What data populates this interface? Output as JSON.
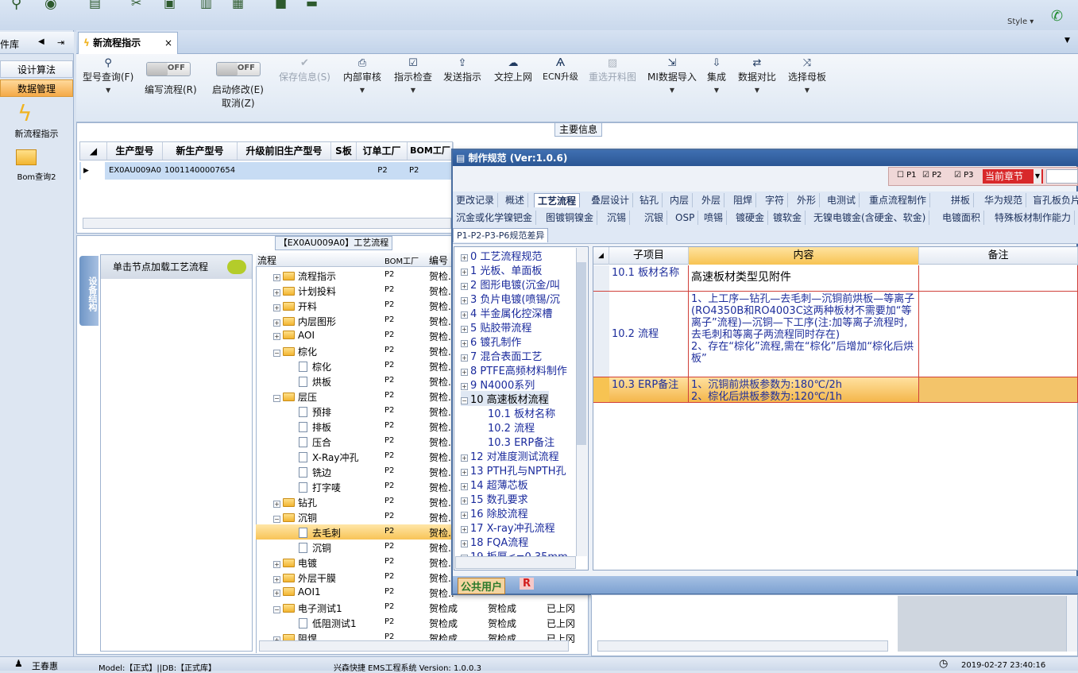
{
  "window": {
    "style_label": "Style ▾"
  },
  "sidebar": {
    "header": "件库",
    "buttons": [
      {
        "label": "设计算法"
      },
      {
        "label": "数据管理"
      }
    ],
    "items": [
      {
        "label": "新流程指示"
      },
      {
        "label": "Bom查询2"
      }
    ]
  },
  "tab": {
    "label": "新流程指示",
    "close": "×"
  },
  "toolbar": {
    "query": "型号查询(F)",
    "edit_flow": "编写流程(R)",
    "start_edit": "启动修改(E)",
    "cancel": "取消(Z)",
    "toggle_off": "OFF",
    "save_info": "保存信息(S)",
    "internal_review": "内部审核",
    "instruction_check": "指示检查",
    "send_instruction": "发送指示",
    "doc_upload": "文控上网",
    "ecn_upgrade": "ECN升级",
    "reselect_cut": "重选开料图",
    "mi_import": "MI数据导入",
    "integrate": "集成",
    "data_compare": "数据对比",
    "select_master": "选择母板"
  },
  "main_info": {
    "label": "主要信息",
    "columns": [
      "生产型号",
      "新生产型号",
      "升级前旧生产型号",
      "S板",
      "订单工厂",
      "BOM工厂"
    ],
    "row": [
      "EX0AU009A0",
      "10011400007654",
      "",
      "",
      "P2",
      "P2"
    ]
  },
  "process": {
    "title": "【EX0AU009A0】工艺流程",
    "side_tab": "设备结构",
    "panel_hint": "单击节点加载工艺流程",
    "columns": [
      "流程",
      "BOM工厂",
      "编号"
    ],
    "rows": [
      {
        "name": "流程指示",
        "level": 1,
        "folder": true,
        "bom": "P2",
        "c3": "贺检.."
      },
      {
        "name": "计划投料",
        "level": 1,
        "folder": true,
        "bom": "P2",
        "c3": "贺检.."
      },
      {
        "name": "开料",
        "level": 1,
        "folder": true,
        "bom": "P2",
        "c3": "贺检.."
      },
      {
        "name": "内层图形",
        "level": 1,
        "folder": true,
        "bom": "P2",
        "c3": "贺检.."
      },
      {
        "name": "AOI",
        "level": 1,
        "folder": true,
        "bom": "P2",
        "c3": "贺检.."
      },
      {
        "name": "棕化",
        "level": 1,
        "folder": true,
        "bom": "P2",
        "c3": "贺检.."
      },
      {
        "name": "棕化",
        "level": 2,
        "folder": false,
        "bom": "P2",
        "c3": "贺检.."
      },
      {
        "name": "烘板",
        "level": 2,
        "folder": false,
        "bom": "P2",
        "c3": "贺检.."
      },
      {
        "name": "层压",
        "level": 1,
        "folder": true,
        "bom": "P2",
        "c3": "贺检.."
      },
      {
        "name": "预排",
        "level": 2,
        "folder": false,
        "bom": "P2",
        "c3": "贺检.."
      },
      {
        "name": "排板",
        "level": 2,
        "folder": false,
        "bom": "P2",
        "c3": "贺检.."
      },
      {
        "name": "压合",
        "level": 2,
        "folder": false,
        "bom": "P2",
        "c3": "贺检.."
      },
      {
        "name": "X-Ray冲孔",
        "level": 2,
        "folder": false,
        "bom": "P2",
        "c3": "贺检.."
      },
      {
        "name": "铣边",
        "level": 2,
        "folder": false,
        "bom": "P2",
        "c3": "贺检.."
      },
      {
        "name": "打字唛",
        "level": 2,
        "folder": false,
        "bom": "P2",
        "c3": "贺检.."
      },
      {
        "name": "钻孔",
        "level": 1,
        "folder": true,
        "bom": "P2",
        "c3": "贺检.."
      },
      {
        "name": "沉铜",
        "level": 1,
        "folder": true,
        "bom": "P2",
        "c3": "贺检.."
      },
      {
        "name": "去毛刺",
        "level": 2,
        "folder": false,
        "bom": "P2",
        "c3": "贺检.."
      },
      {
        "name": "沉铜",
        "level": 2,
        "folder": false,
        "bom": "P2",
        "c3": "贺检.."
      },
      {
        "name": "电镀",
        "level": 1,
        "folder": true,
        "bom": "P2",
        "c3": "贺检.."
      },
      {
        "name": "外层干膜",
        "level": 1,
        "folder": true,
        "bom": "P2",
        "c3": "贺检.."
      },
      {
        "name": "AOI1",
        "level": 1,
        "folder": true,
        "bom": "P2",
        "c3": "贺检.."
      },
      {
        "name": "电子测试1",
        "level": 1,
        "folder": true,
        "bom": "P2",
        "c3": "贺检成",
        "c4": "贺检成",
        "c5": "已上冈"
      },
      {
        "name": "低阻测试1",
        "level": 2,
        "folder": false,
        "bom": "P2",
        "c3": "贺检成",
        "c4": "贺检成",
        "c5": "已上冈"
      },
      {
        "name": "阻焊",
        "level": 1,
        "folder": true,
        "bom": "P2",
        "c3": "贺检成",
        "c4": "贺检成",
        "c5": "已上冈"
      }
    ]
  },
  "dialog": {
    "title": "制作规范 (Ver:1.0.6)",
    "options": {
      "p1": "P1",
      "p2": "P2",
      "p3": "P3",
      "scope": "当前章节"
    },
    "tabs_row1": [
      "更改记录",
      "概述",
      "工艺流程",
      "叠层设计",
      "钻孔",
      "内层",
      "外层",
      "阻焊",
      "字符",
      "外形",
      "电测试",
      "重点流程制作",
      "拼板",
      "华为规范",
      "盲孔板负片"
    ],
    "tabs_row2": [
      "沉金或化学镍钯金",
      "图镀铜镍金",
      "沉锡",
      "沉银",
      "OSP",
      "喷锡",
      "镀硬金",
      "镀软金",
      "无镍电镀金(含硬金、软金)",
      "电镀面积",
      "特殊板材制作能力"
    ],
    "tabs_row3": [
      "P1-P2-P3-P6规范差异"
    ],
    "tree": [
      "0 工艺流程规范",
      "1 光板、单面板",
      "2 图形电镀(沉金/叫",
      "3 负片电镀(喷锡/沉",
      "4 半金属化控深槽",
      "5 贴胶带流程",
      "6 镀孔制作",
      "7 混合表面工艺",
      "8 PTFE高频材料制作",
      "9 N4000系列",
      "10 高速板材流程",
      "10.1 板材名称",
      "10.2 流程",
      "10.3 ERP备注",
      "12 对准度测试流程",
      "13 PTH孔与NPTH孔",
      "14 超薄芯板",
      "15 数孔要求",
      "16 除胶流程",
      "17 X-ray冲孔流程",
      "18 FQA流程",
      "19 板厚<=0.35mm"
    ],
    "grid_columns": [
      "子项目",
      "内容",
      "备注"
    ],
    "grid_rows": [
      {
        "item": "10.1 板材名称",
        "content": "高速板材类型见附件",
        "note": ""
      },
      {
        "item": "10.2 流程",
        "content": "1、上工序—钻孔—去毛刺—沉铜前烘板—等离子(RO4350B和RO4003C这两种板材不需要加“等离子”流程)—沉铜—下工序(注:加等离子流程时,去毛刺和等离子两流程同时存在)\n2、存在“棕化”流程,需在“棕化”后增加“棕化后烘板”",
        "note": ""
      },
      {
        "item": "10.3 ERP备注",
        "content": "1、沉铜前烘板参数为:180℃/2h\n2、棕化后烘板参数为:120℃/1h",
        "note": ""
      }
    ],
    "footer_user": "公共用户",
    "footer_r": "R"
  },
  "status": {
    "user": "王春惠",
    "model": "Model:【正式】||DB:【正式库】",
    "system": "兴森快捷 EMS工程系统 Version: 1.0.0.3",
    "datetime": "2019-02-27 23:40:16"
  },
  "colors": {
    "accent": "#2b5694",
    "selection": "#f8c457",
    "grid_border": "#d0403a"
  }
}
